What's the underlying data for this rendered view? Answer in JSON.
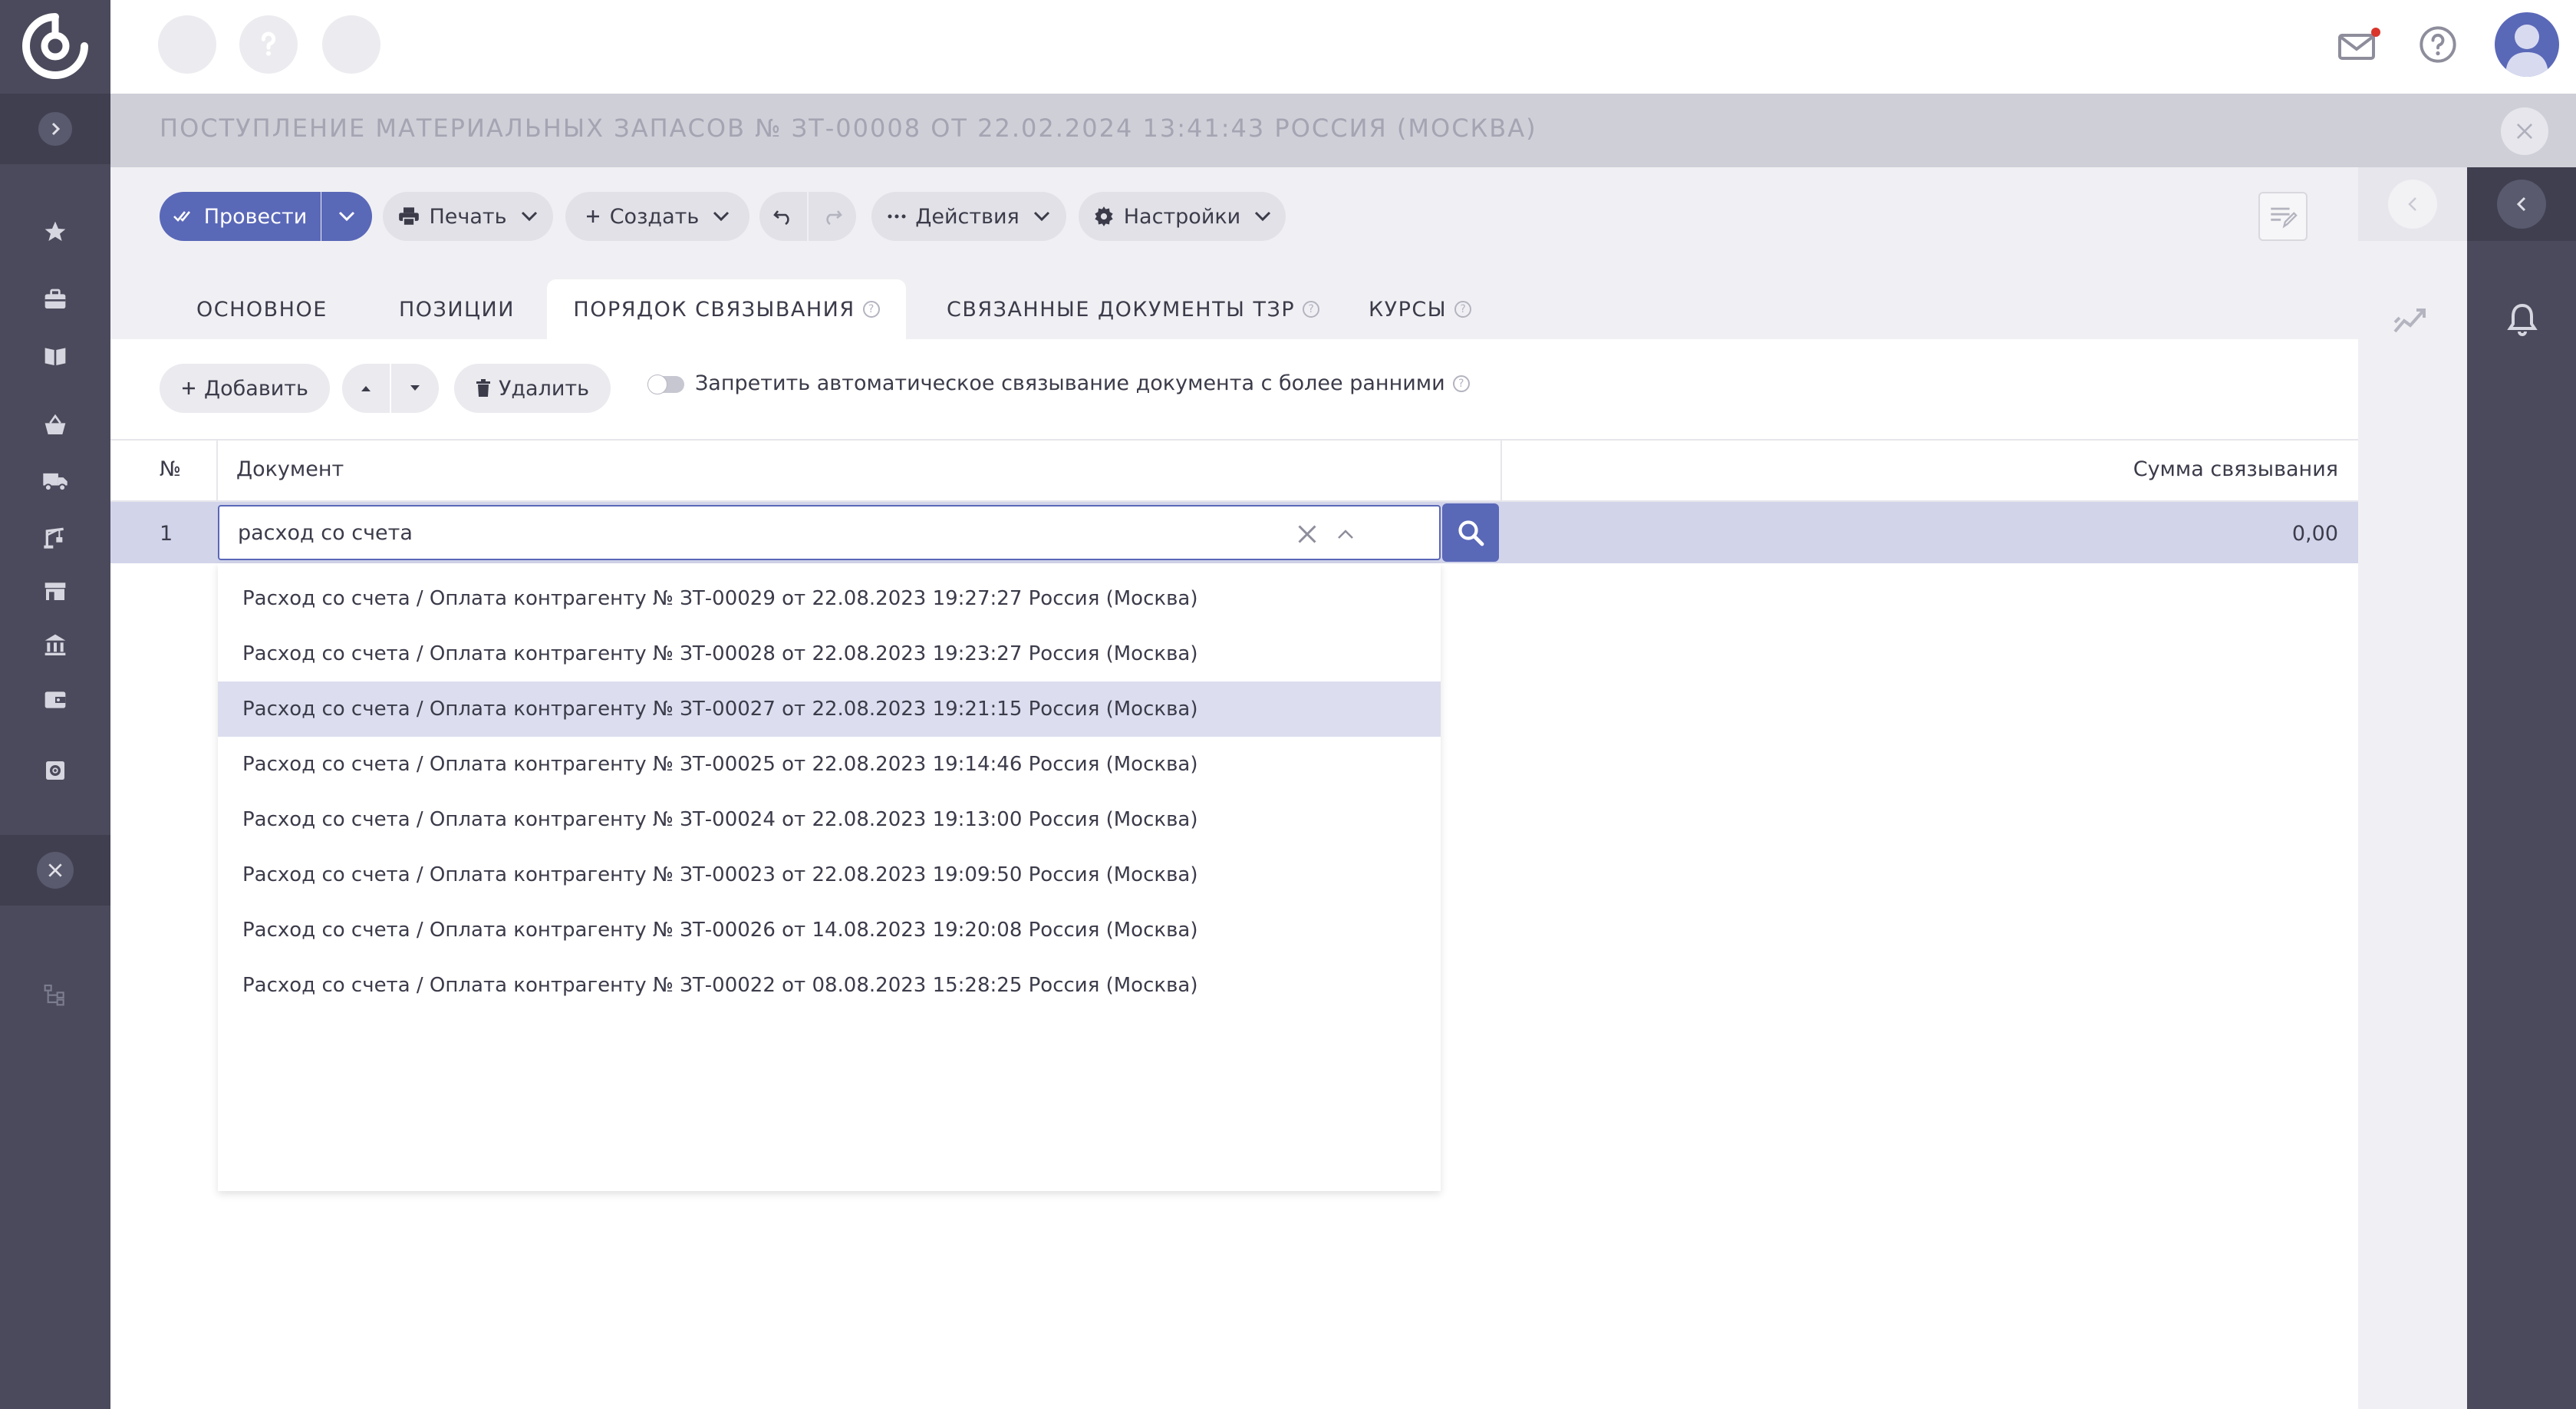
{
  "header": {
    "document_title": "ПОСТУПЛЕНИЕ МАТЕРИАЛЬНЫХ ЗАПАСОВ № ЗТ-00008 ОТ 22.02.2024 13:41:43 РОССИЯ (МОСКВА)"
  },
  "topbar_icons": [
    "mail-icon",
    "help-icon",
    "user-avatar-icon"
  ],
  "sidebar_icons": [
    "favorites-star-icon",
    "briefcase-icon",
    "book-icon",
    "basket-icon",
    "truck-icon",
    "crane-icon",
    "store-icon",
    "bank-icon",
    "wallet-icon",
    "settings-gear-icon",
    "sitemap-icon"
  ],
  "toolbar": {
    "post_label": "Провести",
    "print_label": "Печать",
    "create_label": "Создать",
    "actions_label": "Действия",
    "settings_label": "Настройки"
  },
  "tabs": [
    {
      "label": "ОСНОВНОЕ",
      "active": false
    },
    {
      "label": "ПОЗИЦИИ",
      "active": false
    },
    {
      "label": "ПОРЯДОК СВЯЗЫВАНИЯ",
      "active": true
    },
    {
      "label": "СВЯЗАННЫЕ ДОКУМЕНТЫ ТЗР",
      "active": false
    },
    {
      "label": "КУРСЫ",
      "active": false
    }
  ],
  "actions": {
    "add_label": "Добавить",
    "delete_label": "Удалить",
    "toggle_label": "Запретить автоматическое связывание документа с более ранними",
    "toggle_on": false
  },
  "table": {
    "columns": [
      "№",
      "Документ",
      "Сумма связывания"
    ],
    "rows": [
      {
        "num": "1",
        "document_input": "расход со счета",
        "sum": "0,00"
      }
    ]
  },
  "dropdown": {
    "highlighted_index": 2,
    "items": [
      "Расход со счета / Оплата контрагенту № ЗТ-00029 от 22.08.2023 19:27:27 Россия (Москва)",
      "Расход со счета / Оплата контрагенту № ЗТ-00028 от 22.08.2023 19:23:27 Россия (Москва)",
      "Расход со счета / Оплата контрагенту № ЗТ-00027 от 22.08.2023 19:21:15 Россия (Москва)",
      "Расход со счета / Оплата контрагенту № ЗТ-00025 от 22.08.2023 19:14:46 Россия (Москва)",
      "Расход со счета / Оплата контрагенту № ЗТ-00024 от 22.08.2023 19:13:00 Россия (Москва)",
      "Расход со счета / Оплата контрагенту № ЗТ-00023 от 22.08.2023 19:09:50 Россия (Москва)",
      "Расход со счета / Оплата контрагенту № ЗТ-00026 от 14.08.2023 19:20:08 Россия (Москва)",
      "Расход со счета / Оплата контрагенту № ЗТ-00022 от 08.08.2023 15:28:25 Россия (Москва)"
    ]
  },
  "colors": {
    "accent": "#5a68b8",
    "sidebar": "#4a4a5c",
    "row_highlight": "#d2d4ea",
    "notification_dot": "#d9352a"
  }
}
